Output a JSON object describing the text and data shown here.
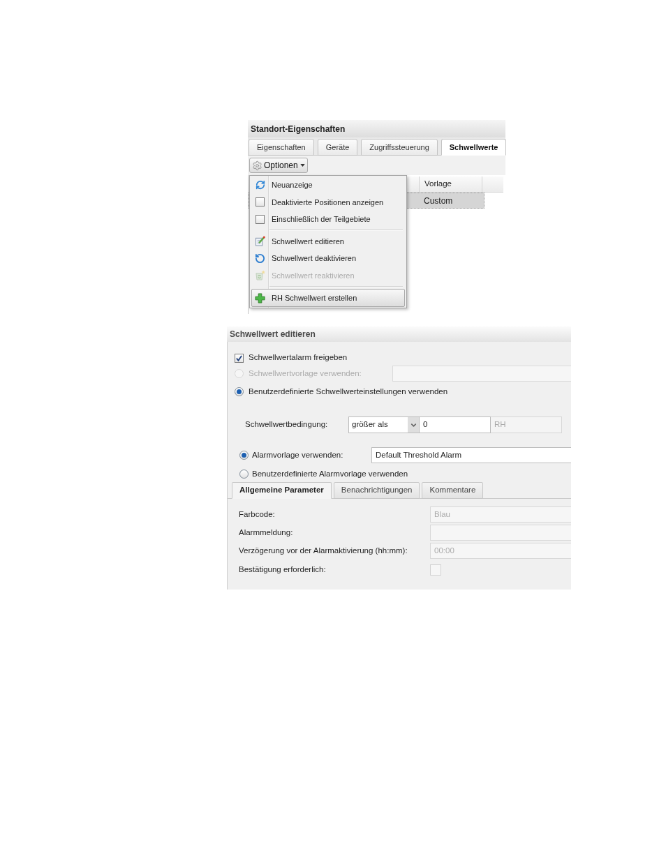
{
  "site_panel": {
    "title": "Standort-Eigenschaften",
    "tabs": [
      {
        "label": "Eigenschaften",
        "selected": false
      },
      {
        "label": "Geräte",
        "selected": false
      },
      {
        "label": "Zugriffssteuerung",
        "selected": false
      },
      {
        "label": "Schwellwerte",
        "selected": true
      }
    ],
    "options_button": {
      "label": "Optionen"
    },
    "grid": {
      "columns": [
        "Vorlage"
      ],
      "rows": [
        {
          "cells": [
            "Custom"
          ],
          "selected": true
        }
      ]
    },
    "options_menu": [
      {
        "kind": "refresh",
        "label": "Neuanzeige",
        "disabled": false,
        "highlighted": false
      },
      {
        "kind": "checkbox",
        "label": "Deaktivierte Positionen anzeigen",
        "checked": false,
        "disabled": false,
        "highlighted": false
      },
      {
        "kind": "checkbox",
        "label": "Einschließlich der Teilgebiete",
        "checked": false,
        "disabled": false,
        "highlighted": false
      },
      {
        "kind": "separator"
      },
      {
        "kind": "edit",
        "label": "Schwellwert editieren",
        "disabled": false,
        "highlighted": false
      },
      {
        "kind": "deactivate",
        "label": "Schwellwert deaktivieren",
        "disabled": false,
        "highlighted": false
      },
      {
        "kind": "reactivate",
        "label": "Schwellwert reaktivieren",
        "disabled": true,
        "highlighted": false
      },
      {
        "kind": "separator"
      },
      {
        "kind": "create",
        "label": "RH Schwellwert erstellen",
        "disabled": false,
        "highlighted": true
      }
    ]
  },
  "edit_panel": {
    "title": "Schwellwert editieren",
    "enable_alarm": {
      "label": "Schwellwertalarm freigeben",
      "checked": true
    },
    "threshold_options": [
      {
        "kind": "template",
        "label": "Schwellwertvorlage verwenden:",
        "selected": false,
        "disabled": true
      },
      {
        "kind": "custom",
        "label": "Benutzerdefinierte Schwellwerteinstellungen verwenden",
        "selected": true,
        "disabled": false
      }
    ],
    "condition": {
      "label": "Schwellwertbedingung:",
      "operator": "größer als",
      "value": "0",
      "unit": "RH"
    },
    "alarm_options": [
      {
        "kind": "template",
        "label": "Alarmvorlage verwenden:",
        "selected": true,
        "value": "Default Threshold Alarm"
      },
      {
        "kind": "custom",
        "label": "Benutzerdefinierte Alarmvorlage verwenden",
        "selected": false
      }
    ],
    "tabs": [
      {
        "label": "Allgemeine Parameter",
        "selected": true
      },
      {
        "label": "Benachrichtigungen",
        "selected": false
      },
      {
        "label": "Kommentare",
        "selected": false
      }
    ],
    "parameters": [
      {
        "kind": "text",
        "label": "Farbcode:",
        "value": "Blau",
        "disabled": true
      },
      {
        "kind": "text",
        "label": "Alarmmeldung:",
        "disabled": true
      },
      {
        "kind": "text",
        "label": "Verzögerung vor der Alarmaktivierung (hh:mm):",
        "value": "00:00",
        "disabled": true
      },
      {
        "kind": "checkbox",
        "label": "Bestätigung erforderlich:",
        "checked": false,
        "disabled": true
      }
    ]
  }
}
